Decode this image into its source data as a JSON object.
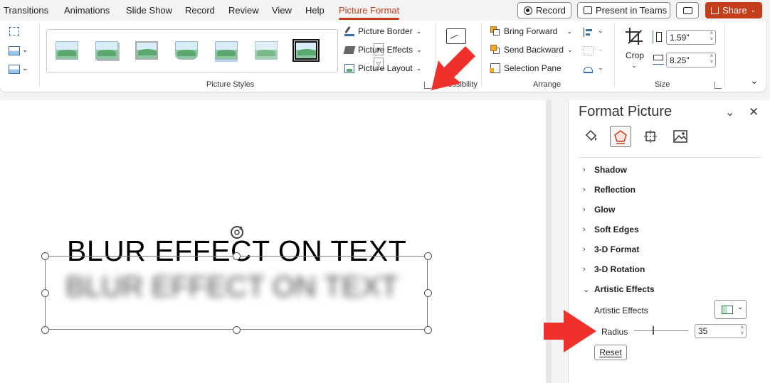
{
  "menu": {
    "tabs": [
      "Transitions",
      "Animations",
      "Slide Show",
      "Record",
      "Review",
      "View",
      "Help",
      "Picture Format"
    ],
    "active_tab": "Picture Format",
    "record_button": "Record",
    "present_button": "Present in Teams",
    "share_button": "Share"
  },
  "ribbon": {
    "picture_styles_label": "Picture Styles",
    "picture_border": "Picture Border",
    "picture_effects": "Picture Effects",
    "picture_layout": "Picture Layout",
    "accessibility_label": "Accessibility",
    "bring_forward": "Bring Forward",
    "send_backward": "Send Backward",
    "selection_pane": "Selection Pane",
    "arrange_label": "Arrange",
    "crop_label": "Crop",
    "height_value": "1.59\"",
    "width_value": "8.25\"",
    "size_label": "Size"
  },
  "slide": {
    "title_text": "BLUR EFFECT ON TEXT",
    "blurred_text": "BLUR EFFECT ON TEXT"
  },
  "pane": {
    "title": "Format Picture",
    "sections": [
      "Shadow",
      "Reflection",
      "Glow",
      "Soft Edges",
      "3-D Format",
      "3-D Rotation",
      "Artistic Effects"
    ],
    "expanded_section": "Artistic Effects",
    "artistic_effects_label": "Artistic Effects",
    "radius_label": "Radius",
    "radius_value": "35",
    "radius_level": 0.35,
    "reset_label": "Reset"
  },
  "colors": {
    "accent": "#c43e1c",
    "annotation_arrow": "#f0302a"
  }
}
